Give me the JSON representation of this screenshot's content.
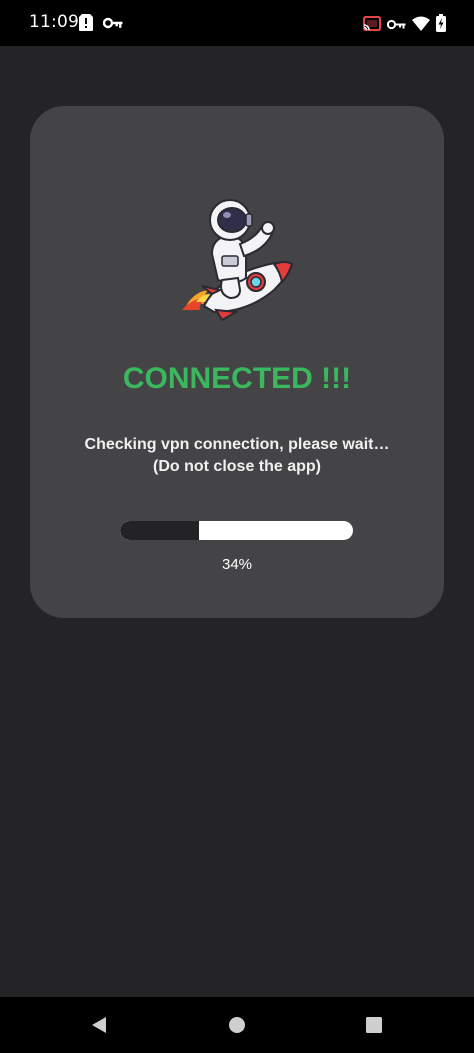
{
  "status_bar": {
    "time": "11:09",
    "icons_left": [
      "sim-alert-icon",
      "vpn-key-icon"
    ],
    "icons_right": [
      "cast-icon",
      "vpn-key-icon",
      "wifi-icon",
      "battery-icon"
    ]
  },
  "main": {
    "headline": "CONNECTED !!!",
    "headline_color": "#3bb85e",
    "message_line1": "Checking vpn connection, please wait…",
    "message_line2": "(Do not close the app)",
    "progress": {
      "percent": 34,
      "label": "34%"
    },
    "illustration": "astronaut-riding-rocket"
  },
  "nav_bar": {
    "buttons": [
      "back-icon",
      "home-icon",
      "recents-icon"
    ]
  }
}
